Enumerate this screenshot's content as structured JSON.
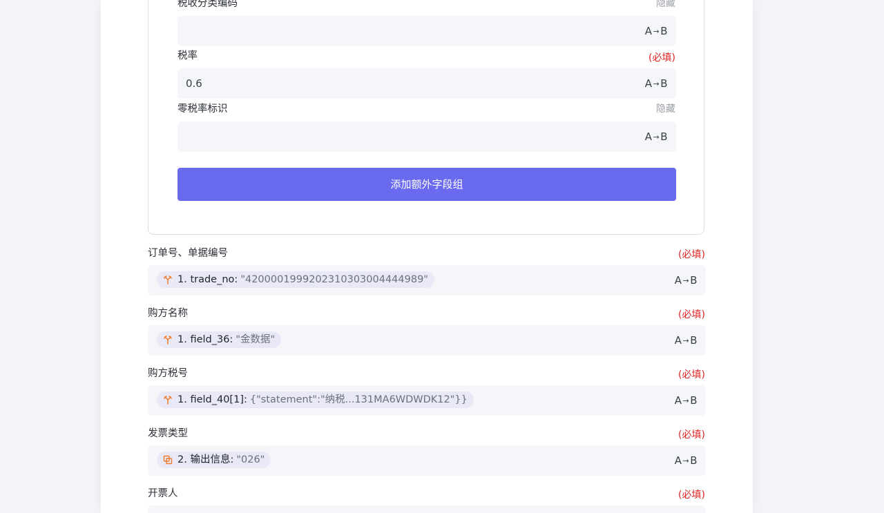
{
  "colors": {
    "primary_button": "#6a6aef",
    "required": "#e02020",
    "hidden_tag": "#9a9ea8",
    "field_bg": "#f5f6f9",
    "chip_bg": "#e8e8f7",
    "chip_icon": "#f07a2b"
  },
  "inner_fields": [
    {
      "label": "税收分类编码",
      "tag": "隐藏",
      "value": "",
      "ab": "A→B"
    },
    {
      "label": "税率",
      "tag": "(必填)",
      "value": "0.6",
      "ab": "A→B"
    },
    {
      "label": "零税率标识",
      "tag": "隐藏",
      "value": "",
      "ab": "A→B"
    }
  ],
  "add_group_button": "添加额外字段组",
  "ab_a": "A",
  "ab_b": "B",
  "ab_arrow": "→",
  "outer_fields": [
    {
      "label": "订单号、单据编号",
      "tag": "(必填)",
      "chip_key": "1. trade_no:",
      "chip_val": "\"4200001999202310303004444989\"",
      "icon": "branch-icon"
    },
    {
      "label": "购方名称",
      "tag": "(必填)",
      "chip_key": "1. field_36:",
      "chip_val": "\"金数据\"",
      "icon": "branch-icon"
    },
    {
      "label": "购方税号",
      "tag": "(必填)",
      "chip_key": "1. field_40[1]:",
      "chip_val": "{\"statement\":\"纳税...131MA6WDWDK12\"}}",
      "icon": "branch-icon"
    },
    {
      "label": "发票类型",
      "tag": "(必填)",
      "chip_key": "2. 输出信息:",
      "chip_val": "\"026\"",
      "icon": "copy-icon"
    },
    {
      "label": "开票人",
      "tag": "(必填)"
    }
  ]
}
